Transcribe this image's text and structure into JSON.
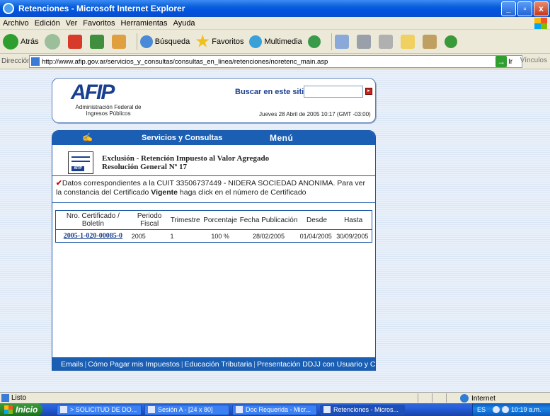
{
  "window": {
    "title": "Retenciones - Microsoft Internet Explorer",
    "min_label": "_",
    "max_label": "▫",
    "close_label": "x"
  },
  "menubar": {
    "items": [
      "Archivo",
      "Edición",
      "Ver",
      "Favoritos",
      "Herramientas",
      "Ayuda"
    ]
  },
  "toolbar": {
    "back_label": "Atrás",
    "search_label": "Búsqueda",
    "favorites_label": "Favoritos",
    "multimedia_label": "Multimedia"
  },
  "addressbar": {
    "label": "Dirección",
    "url": "http://www.afip.gov.ar/servicios_y_consultas/consultas_en_linea/retenciones/noretenc_main.asp",
    "go_label": "Ir",
    "links_label": "Vínculos"
  },
  "header": {
    "logo_text": "AFIP",
    "org_line1": "Administración Federal de",
    "org_line2": "Ingresos Públicos",
    "search_label": "Buscar en este sitio",
    "search_value": "",
    "date_text": "Jueves 28 Abril de 2005 10:17 (GMT -03:00)"
  },
  "nav": {
    "services_label": "Servicios y Consultas",
    "menu_label": "Menú"
  },
  "exclusion": {
    "title_line1": "Exclusión - Retención Impuesto al Valor Agregado",
    "title_line2": "Resolución General Nº 17",
    "icon_label": "AFIP"
  },
  "info": {
    "text_before": "Datos correspondientes a la CUIT 33506737449 - NIDERA SOCIEDAD ANONIMA. Para ver la constancia del Certificado ",
    "text_bold": "Vigente",
    "text_after": " haga click en el número de Certificado"
  },
  "table": {
    "headers": [
      "Nro. Certificado / Boletín",
      "Periodo Fiscal",
      "Trimestre",
      "Porcentaje",
      "Fecha Publicación",
      "Desde",
      "Hasta"
    ],
    "rows": [
      {
        "certificado": "2005-1-020-00085-0",
        "periodo": "2005",
        "trimestre": "1",
        "porcentaje": "100 %",
        "fecha": "28/02/2005",
        "desde": "01/04/2005",
        "hasta": "30/09/2005"
      }
    ]
  },
  "footer": {
    "links": [
      "Emails",
      "Cómo Pagar mis Impuestos",
      "Educación Tributaria",
      "Presentación DDJJ con Usuario y Clave"
    ],
    "separator": "|"
  },
  "statusbar": {
    "status": "Listo",
    "zone": "Internet"
  },
  "taskbar": {
    "start_label": "Inicio",
    "tasks": [
      "> SOLICITUD DE DO...",
      "Sesión A - [24 x 80]",
      "Doc Requerida - Micr...",
      "Retenciones - Micros..."
    ],
    "lang": "ES",
    "time": "10:19 a.m."
  }
}
